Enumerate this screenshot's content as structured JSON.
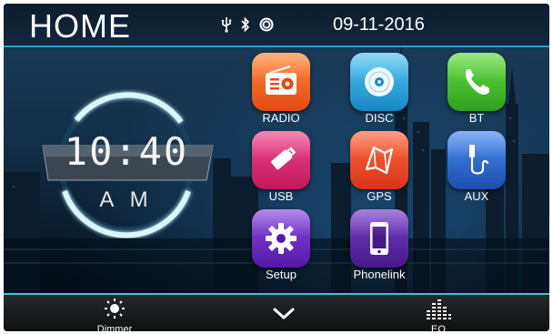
{
  "header": {
    "title": "HOME",
    "date": "09-11-2016"
  },
  "status": {
    "icons": [
      "usb-icon",
      "bluetooth-icon",
      "disc-icon"
    ]
  },
  "clock": {
    "time": "10:40",
    "ampm": "A M"
  },
  "apps": [
    {
      "label": "RADIO",
      "icon": "radio-icon",
      "color": "#e8501e"
    },
    {
      "label": "DISC",
      "icon": "disc-icon",
      "color": "#2aa0d8"
    },
    {
      "label": "BT",
      "icon": "phone-icon",
      "color": "#3cbf2c"
    },
    {
      "label": "USB",
      "icon": "usb-stick-icon",
      "color": "#d9266e"
    },
    {
      "label": "GPS",
      "icon": "map-icon",
      "color": "#e8401e"
    },
    {
      "label": "AUX",
      "icon": "aux-cable-icon",
      "color": "#2a68c8"
    },
    {
      "label": "Setup",
      "icon": "gear-icon",
      "color": "#6a2cc0"
    },
    {
      "label": "Phonelink",
      "icon": "smartphone-icon",
      "color": "#5b2a9e"
    }
  ],
  "bottom_bar": {
    "dimmer_label": "Dimmer",
    "eq_label": "EQ",
    "accent": "#3cc4d6"
  }
}
